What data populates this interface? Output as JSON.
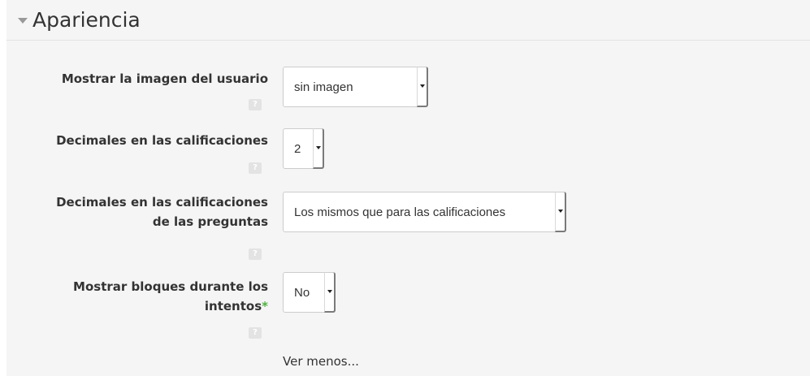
{
  "section": {
    "title": "Apariencia",
    "collapse_icon": "triangle-down-icon"
  },
  "fields": [
    {
      "label": "Mostrar la imagen del usuario",
      "value": "sin imagen",
      "help": "?"
    },
    {
      "label": "Decimales en las calificaciones",
      "value": "2",
      "help": "?"
    },
    {
      "label_line1": "Decimales en las calificaciones",
      "label_line2": "de las preguntas",
      "value": "Los mismos que para las calificaciones",
      "help": "?"
    },
    {
      "label_line1": "Mostrar bloques durante los",
      "label_line2": "intentos",
      "required": "*",
      "value": "No",
      "help": "?"
    }
  ],
  "colors": {
    "panel_background": "#f5f5f5",
    "required_mark": "#4fb141",
    "help_icon_background": "#e3e3e3"
  },
  "show_less_link": "Ver menos..."
}
